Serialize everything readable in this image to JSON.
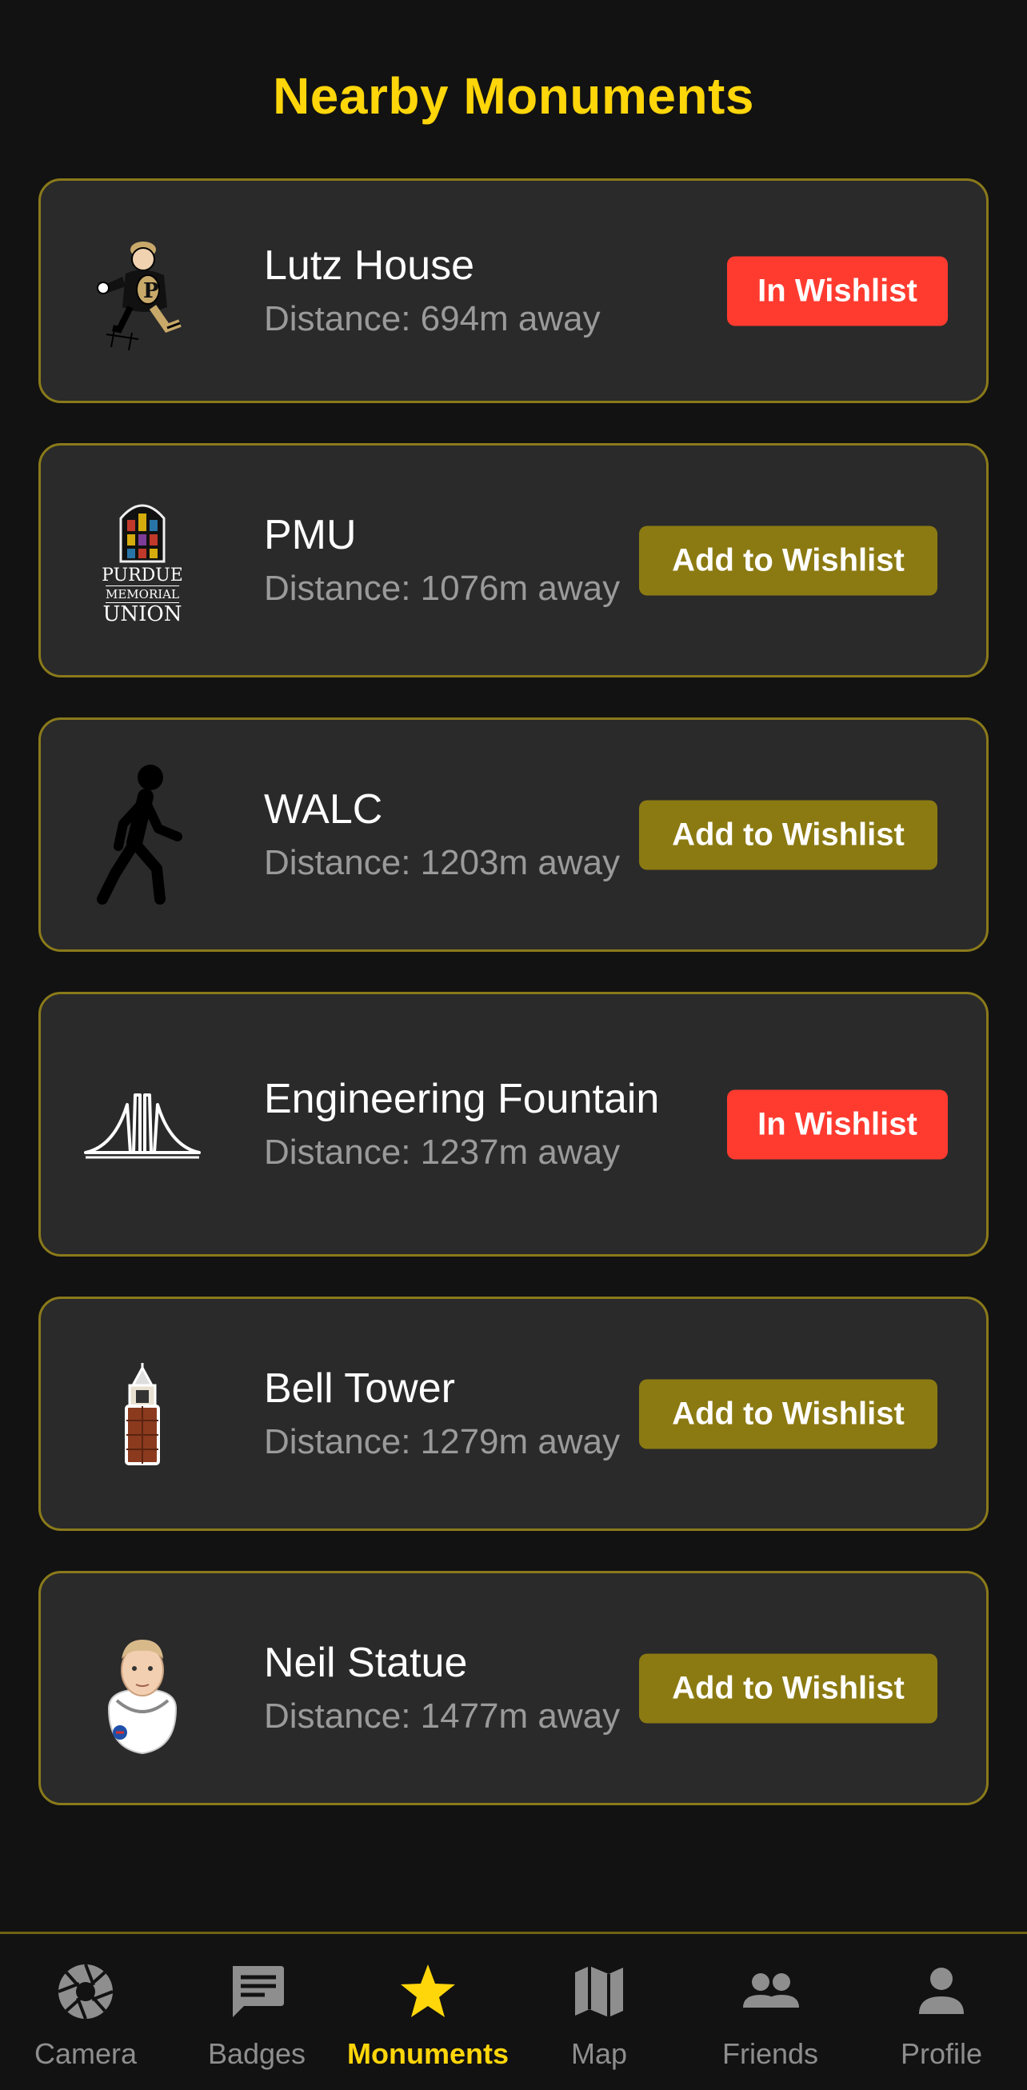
{
  "header": {
    "title": "Nearby Monuments"
  },
  "monuments": [
    {
      "name": "Lutz House",
      "distance": "Distance: 694m away",
      "action": "In Wishlist",
      "in_wishlist": true,
      "icon": "football-mascot-icon"
    },
    {
      "name": "PMU",
      "distance": "Distance: 1076m away",
      "action": "Add to Wishlist",
      "in_wishlist": false,
      "icon": "purdue-memorial-union-logo"
    },
    {
      "name": "WALC",
      "distance": "Distance: 1203m away",
      "action": "Add to Wishlist",
      "in_wishlist": false,
      "icon": "walking-person-icon"
    },
    {
      "name": "Engineering Fountain",
      "distance": "Distance: 1237m away",
      "action": "In Wishlist",
      "in_wishlist": true,
      "icon": "fountain-icon"
    },
    {
      "name": "Bell Tower",
      "distance": "Distance: 1279m away",
      "action": "Add to Wishlist",
      "in_wishlist": false,
      "icon": "bell-tower-icon"
    },
    {
      "name": "Neil Statue",
      "distance": "Distance: 1477m away",
      "action": "Add to Wishlist",
      "in_wishlist": false,
      "icon": "astronaut-icon"
    }
  ],
  "pmu_logo": {
    "line1": "PURDUE",
    "line2": "MEMORIAL",
    "line3": "UNION"
  },
  "tabs": [
    {
      "label": "Camera",
      "icon": "camera-aperture-icon",
      "active": false
    },
    {
      "label": "Badges",
      "icon": "message-icon",
      "active": false
    },
    {
      "label": "Monuments",
      "icon": "star-icon",
      "active": true
    },
    {
      "label": "Map",
      "icon": "map-icon",
      "active": false
    },
    {
      "label": "Friends",
      "icon": "people-icon",
      "active": false
    },
    {
      "label": "Profile",
      "icon": "person-icon",
      "active": false
    }
  ],
  "colors": {
    "accent": "#FFD60A",
    "in_wishlist_button": "#FF3B30",
    "add_wishlist_button": "#8B7A12",
    "card_background": "#2a2a2a",
    "card_border": "#8a7a1a",
    "page_background": "#121212",
    "inactive_tab": "#8e8e8e"
  }
}
